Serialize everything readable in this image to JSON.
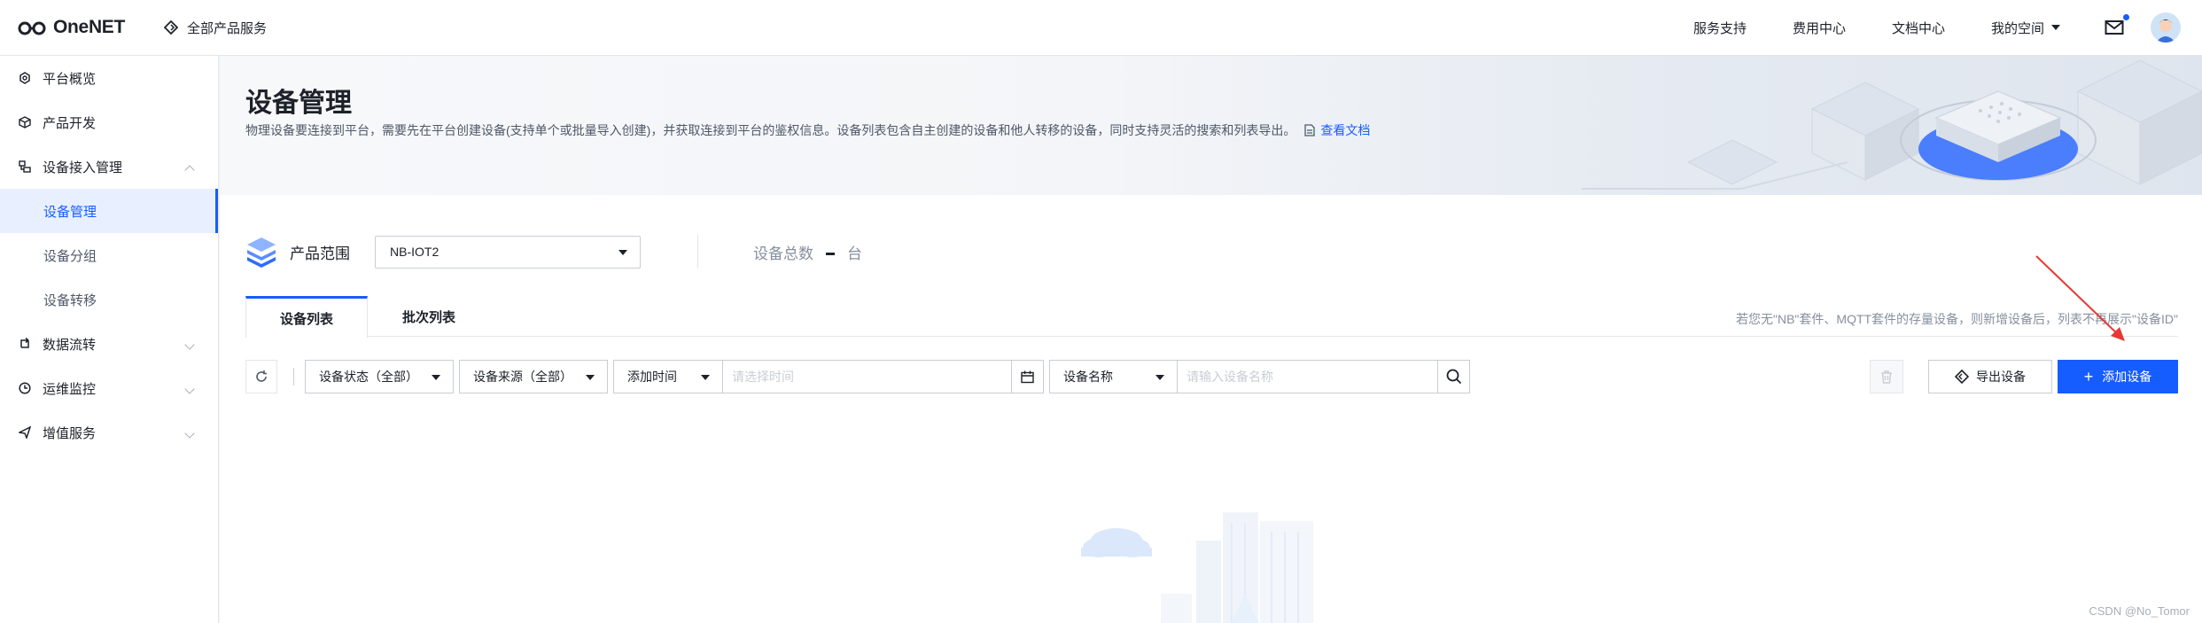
{
  "header": {
    "logo_text": "OneNET",
    "all_products": "全部产品服务",
    "links": [
      "服务支持",
      "费用中心",
      "文档中心"
    ],
    "my_space": "我的空间"
  },
  "sidebar": {
    "items": [
      {
        "label": "平台概览",
        "icon": "gear-icon"
      },
      {
        "label": "产品开发",
        "icon": "cube-icon"
      },
      {
        "label": "设备接入管理",
        "icon": "device-icon"
      },
      {
        "label": "数据流转",
        "icon": "flow-icon"
      },
      {
        "label": "运维监控",
        "icon": "monitor-icon"
      },
      {
        "label": "增值服务",
        "icon": "send-icon"
      }
    ],
    "sub_items": [
      "设备管理",
      "设备分组",
      "设备转移"
    ]
  },
  "banner": {
    "title": "设备管理",
    "description": "物理设备要连接到平台，需要先在平台创建设备(支持单个或批量导入创建)，并获取连接到平台的鉴权信息。设备列表包含自主创建的设备和他人转移的设备，同时支持灵活的搜索和列表导出。",
    "doc_link": "查看文档"
  },
  "product": {
    "label": "产品范围",
    "selected": "NB-IOT2",
    "total_label": "设备总数",
    "total_unit": "台"
  },
  "tabs": {
    "device_list": "设备列表",
    "batch_list": "批次列表",
    "hint": "若您无\"NB\"套件、MQTT套件的存量设备，则新增设备后，列表不再展示\"设备ID\""
  },
  "filters": {
    "status": "设备状态（全部）",
    "source": "设备来源（全部）",
    "time_type": "添加时间",
    "time_placeholder": "请选择时间",
    "name_type": "设备名称",
    "name_placeholder": "请输入设备名称"
  },
  "actions": {
    "export": "导出设备",
    "add": "添加设备"
  },
  "watermark": "CSDN @No_Tomor",
  "colors": {
    "primary": "#165dff",
    "annotation_arrow": "#e53935"
  }
}
